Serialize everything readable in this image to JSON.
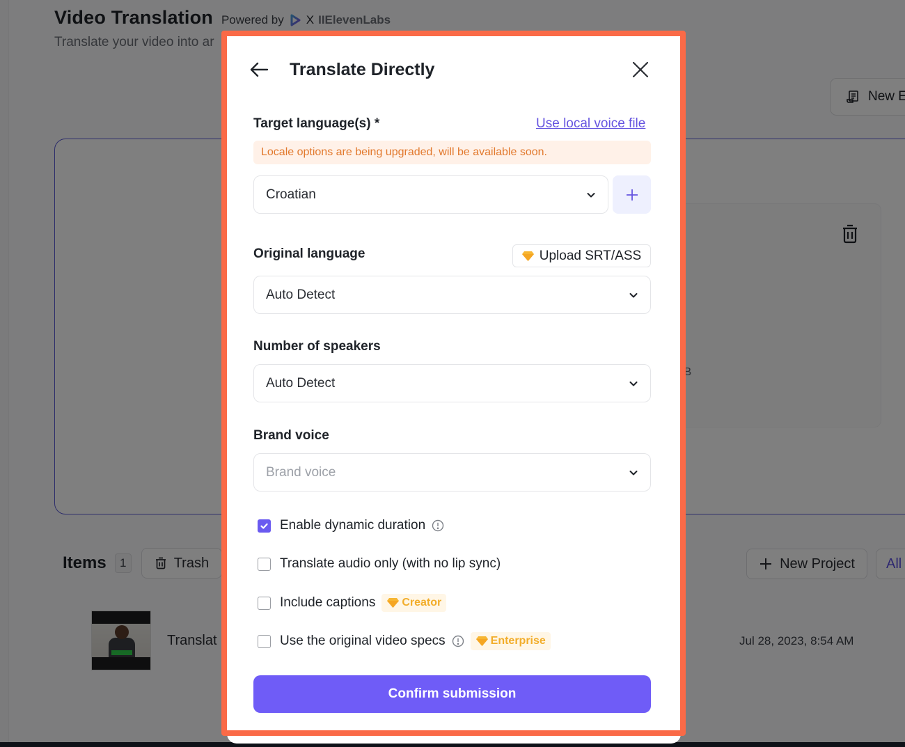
{
  "page": {
    "title": "Video Translation",
    "powered_by": "Powered by",
    "partner_separator": "X",
    "partner_name": "IIElevenLabs",
    "subtitle": "Translate your video into ar",
    "new_button_label": "New E",
    "size_text": "GB",
    "items_title": "Items",
    "items_count": "1",
    "trash_label": "Trash",
    "new_project_label": "New Project",
    "all_filter_label": "All",
    "item": {
      "name": "Translat",
      "date": "Jul 28, 2023, 8:54 AM"
    }
  },
  "modal": {
    "title": "Translate Directly",
    "target_language": {
      "label": "Target language(s) *",
      "link": "Use local voice file",
      "notice": "Locale options are being upgraded, will be available soon.",
      "value": "Croatian"
    },
    "original_language": {
      "label": "Original language",
      "upload_label": "Upload SRT/ASS",
      "value": "Auto Detect"
    },
    "speakers": {
      "label": "Number of speakers",
      "value": "Auto Detect"
    },
    "brand_voice": {
      "label": "Brand voice",
      "placeholder": "Brand voice"
    },
    "options": [
      {
        "label": "Enable dynamic duration",
        "checked": true,
        "info": true,
        "badge": ""
      },
      {
        "label": "Translate audio only (with no lip sync)",
        "checked": false,
        "info": false,
        "badge": ""
      },
      {
        "label": "Include captions",
        "checked": false,
        "info": false,
        "badge": "Creator"
      },
      {
        "label": "Use the original video specs",
        "checked": false,
        "info": true,
        "badge": "Enterprise"
      }
    ],
    "confirm_label": "Confirm submission"
  },
  "colors": {
    "accent": "#6f5cf7",
    "highlight_border": "#fa6a47",
    "notice_text": "#e2792d",
    "notice_bg": "#fff1e8",
    "badge_text": "#f2ad2a",
    "link": "#6554e0"
  }
}
